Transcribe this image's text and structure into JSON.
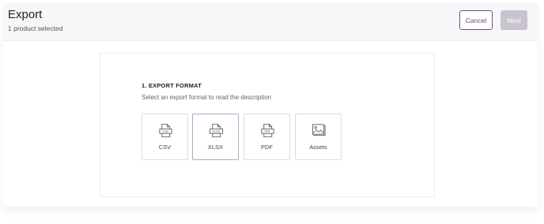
{
  "header": {
    "title": "Export",
    "subtitle": "1 product selected",
    "cancel_label": "Cancel",
    "next_label": "Next"
  },
  "section": {
    "title": "1. EXPORT FORMAT",
    "description": "Select an export format to read the description"
  },
  "formats": [
    {
      "label": "CSV",
      "icon": "csv-file-icon",
      "badge": "CSV",
      "selected": false
    },
    {
      "label": "XLSX",
      "icon": "xlsx-file-icon",
      "badge": "XLSX",
      "selected": true
    },
    {
      "label": "PDF",
      "icon": "pdf-file-icon",
      "badge": "PDF",
      "selected": false
    },
    {
      "label": "Assets",
      "icon": "image-icon",
      "selected": false
    }
  ],
  "colors": {
    "accent": "#6b3f7d",
    "disabled_button": "#c9c3cf",
    "header_bg": "#f7f7fa"
  }
}
